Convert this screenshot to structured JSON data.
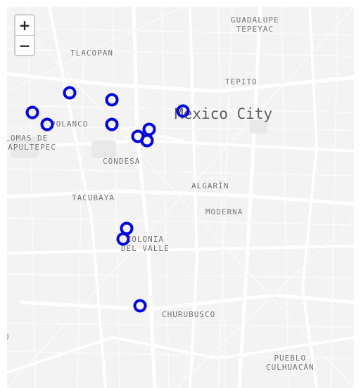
{
  "map": {
    "city_label": "Mexico City",
    "areas": [
      {
        "id": "guadalupe-tepeyac",
        "text": "GUADALUPE\nTEPEYAC"
      },
      {
        "id": "tlacopan",
        "text": "TLACOPAN"
      },
      {
        "id": "tepito",
        "text": "TEPITO"
      },
      {
        "id": "polanco",
        "text": "POLANCO"
      },
      {
        "id": "lomas-de-chapultepec",
        "text": "LOMAS DE\nCHAPULTEPEC"
      },
      {
        "id": "condesa",
        "text": "CONDESA"
      },
      {
        "id": "algarin",
        "text": "ALGARÍN"
      },
      {
        "id": "tacubaya",
        "text": "TACUBAYA"
      },
      {
        "id": "moderna",
        "text": "MODERNA"
      },
      {
        "id": "colonia-del-valle",
        "text": "COLONIA\nDEL VALLE"
      },
      {
        "id": "churubusco",
        "text": "CHURUBUSCO"
      },
      {
        "id": "pueblo-culhuacan",
        "text": "PUEBLO\nCULHUACÁN"
      },
      {
        "id": "edge-label",
        "text": "O"
      }
    ],
    "marker_color": "#0000dd",
    "marker_count": 13
  },
  "zoom": {
    "in_label": "+",
    "out_label": "−"
  }
}
